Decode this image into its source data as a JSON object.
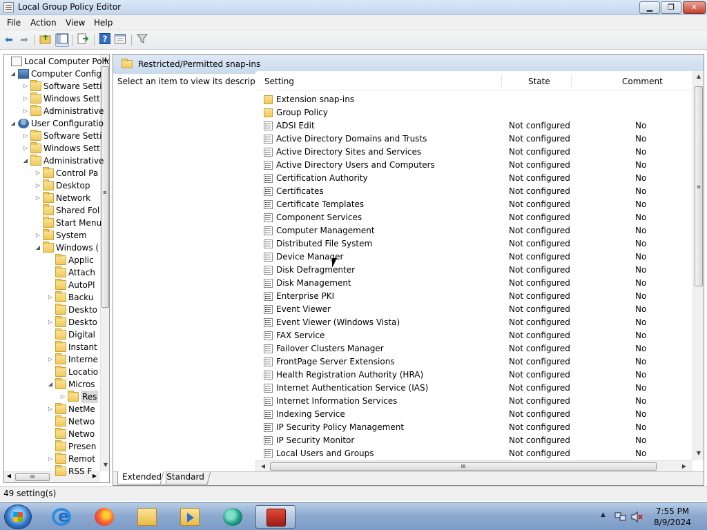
{
  "window": {
    "title": "Local Group Policy Editor"
  },
  "window_buttons": {
    "minimize": "▁",
    "maximize": "❐",
    "close": "✕"
  },
  "menu": [
    "File",
    "Action",
    "View",
    "Help"
  ],
  "toolbar": {
    "icons": [
      "back-arrow-icon",
      "forward-arrow-icon",
      "up-folder-icon",
      "show-hide-tree-icon",
      "export-list-icon",
      "help-icon",
      "properties-icon",
      "filter-icon"
    ]
  },
  "tree": {
    "items": [
      {
        "label": "Local Computer Polic",
        "icon": "doc",
        "level": 0,
        "expander": ""
      },
      {
        "label": "Computer Config",
        "icon": "pc",
        "level": 1,
        "expander": "◢"
      },
      {
        "label": "Software Setti",
        "icon": "folder",
        "level": 2,
        "expander": "▷"
      },
      {
        "label": "Windows Sett",
        "icon": "folder",
        "level": 2,
        "expander": "▷"
      },
      {
        "label": "Administrative",
        "icon": "folder",
        "level": 2,
        "expander": "▷"
      },
      {
        "label": "User Configuratio",
        "icon": "user",
        "level": 1,
        "expander": "◢"
      },
      {
        "label": "Software Setti",
        "icon": "folder",
        "level": 2,
        "expander": "▷"
      },
      {
        "label": "Windows Sett",
        "icon": "folder",
        "level": 2,
        "expander": "▷"
      },
      {
        "label": "Administrative",
        "icon": "folder",
        "level": 2,
        "expander": "◢"
      },
      {
        "label": "Control Pa",
        "icon": "folder",
        "level": 3,
        "expander": "▷"
      },
      {
        "label": "Desktop",
        "icon": "folder",
        "level": 3,
        "expander": "▷"
      },
      {
        "label": "Network",
        "icon": "folder",
        "level": 3,
        "expander": "▷"
      },
      {
        "label": "Shared Fol",
        "icon": "folder",
        "level": 3,
        "expander": ""
      },
      {
        "label": "Start Menu",
        "icon": "folder",
        "level": 3,
        "expander": ""
      },
      {
        "label": "System",
        "icon": "folder",
        "level": 3,
        "expander": "▷"
      },
      {
        "label": "Windows (",
        "icon": "folder",
        "level": 3,
        "expander": "◢"
      },
      {
        "label": "Applic",
        "icon": "folder",
        "level": 4,
        "expander": ""
      },
      {
        "label": "Attach",
        "icon": "folder",
        "level": 4,
        "expander": ""
      },
      {
        "label": "AutoPl",
        "icon": "folder",
        "level": 4,
        "expander": ""
      },
      {
        "label": "Backu",
        "icon": "folder",
        "level": 4,
        "expander": "▷"
      },
      {
        "label": "Deskto",
        "icon": "folder",
        "level": 4,
        "expander": ""
      },
      {
        "label": "Deskto",
        "icon": "folder",
        "level": 4,
        "expander": "▷"
      },
      {
        "label": "Digital",
        "icon": "folder",
        "level": 4,
        "expander": ""
      },
      {
        "label": "Instant",
        "icon": "folder",
        "level": 4,
        "expander": ""
      },
      {
        "label": "Interne",
        "icon": "folder",
        "level": 4,
        "expander": "▷"
      },
      {
        "label": "Locatio",
        "icon": "folder",
        "level": 4,
        "expander": ""
      },
      {
        "label": "Micros",
        "icon": "folder",
        "level": 4,
        "expander": "◢"
      },
      {
        "label": "Res",
        "icon": "folder",
        "level": 5,
        "expander": "▷"
      },
      {
        "label": "NetMe",
        "icon": "folder",
        "level": 4,
        "expander": "▷"
      },
      {
        "label": "Netwo",
        "icon": "folder",
        "level": 4,
        "expander": ""
      },
      {
        "label": "Netwo",
        "icon": "folder",
        "level": 4,
        "expander": ""
      },
      {
        "label": "Presen",
        "icon": "folder",
        "level": 4,
        "expander": ""
      },
      {
        "label": "Remot",
        "icon": "folder",
        "level": 4,
        "expander": "▷"
      },
      {
        "label": "RSS F",
        "icon": "folder",
        "level": 4,
        "expander": ""
      }
    ],
    "scroll_up": "▲",
    "scroll_down": "▼",
    "scroll_left": "◀",
    "scroll_right": "▶",
    "grip": "≡",
    "hgrip": "III"
  },
  "details": {
    "header_title": "Restricted/Permitted snap-ins",
    "description": "Select an item to view its description.",
    "columns": {
      "setting": "Setting",
      "state": "State",
      "comment": "Comment"
    },
    "folders": [
      "Extension snap-ins",
      "Group Policy"
    ],
    "rows": [
      {
        "setting": "ADSI Edit",
        "state": "Not configured",
        "comment": "No"
      },
      {
        "setting": "Active Directory Domains and Trusts",
        "state": "Not configured",
        "comment": "No"
      },
      {
        "setting": "Active Directory Sites and Services",
        "state": "Not configured",
        "comment": "No"
      },
      {
        "setting": "Active Directory Users and Computers",
        "state": "Not configured",
        "comment": "No"
      },
      {
        "setting": "Certification Authority",
        "state": "Not configured",
        "comment": "No"
      },
      {
        "setting": "Certificates",
        "state": "Not configured",
        "comment": "No"
      },
      {
        "setting": "Certificate Templates",
        "state": "Not configured",
        "comment": "No"
      },
      {
        "setting": "Component Services",
        "state": "Not configured",
        "comment": "No"
      },
      {
        "setting": "Computer Management",
        "state": "Not configured",
        "comment": "No"
      },
      {
        "setting": "Distributed File System",
        "state": "Not configured",
        "comment": "No"
      },
      {
        "setting": "Device Manager",
        "state": "Not configured",
        "comment": "No"
      },
      {
        "setting": "Disk Defragmenter",
        "state": "Not configured",
        "comment": "No"
      },
      {
        "setting": "Disk Management",
        "state": "Not configured",
        "comment": "No"
      },
      {
        "setting": "Enterprise PKI",
        "state": "Not configured",
        "comment": "No"
      },
      {
        "setting": "Event Viewer",
        "state": "Not configured",
        "comment": "No"
      },
      {
        "setting": "Event Viewer (Windows Vista)",
        "state": "Not configured",
        "comment": "No"
      },
      {
        "setting": "FAX Service",
        "state": "Not configured",
        "comment": "No"
      },
      {
        "setting": "Failover Clusters Manager",
        "state": "Not configured",
        "comment": "No"
      },
      {
        "setting": "FrontPage Server Extensions",
        "state": "Not configured",
        "comment": "No"
      },
      {
        "setting": "Health Registration Authority (HRA)",
        "state": "Not configured",
        "comment": "No"
      },
      {
        "setting": "Internet Authentication Service (IAS)",
        "state": "Not configured",
        "comment": "No"
      },
      {
        "setting": "Internet Information Services",
        "state": "Not configured",
        "comment": "No"
      },
      {
        "setting": "Indexing Service",
        "state": "Not configured",
        "comment": "No"
      },
      {
        "setting": "IP Security Policy Management",
        "state": "Not configured",
        "comment": "No"
      },
      {
        "setting": "IP Security Monitor",
        "state": "Not configured",
        "comment": "No"
      },
      {
        "setting": "Local Users and Groups",
        "state": "Not configured",
        "comment": "No"
      }
    ],
    "tabs": [
      "Extended",
      "Standard"
    ]
  },
  "status": {
    "text": "49 setting(s)"
  },
  "taskbar": {
    "apps": [
      "internet-explorer-icon",
      "firefox-icon",
      "file-explorer-icon",
      "media-player-icon",
      "app-icon",
      "group-policy-editor-icon"
    ],
    "tray_up": "▲",
    "clock_time": "7:55 PM",
    "clock_date": "8/9/2024"
  }
}
